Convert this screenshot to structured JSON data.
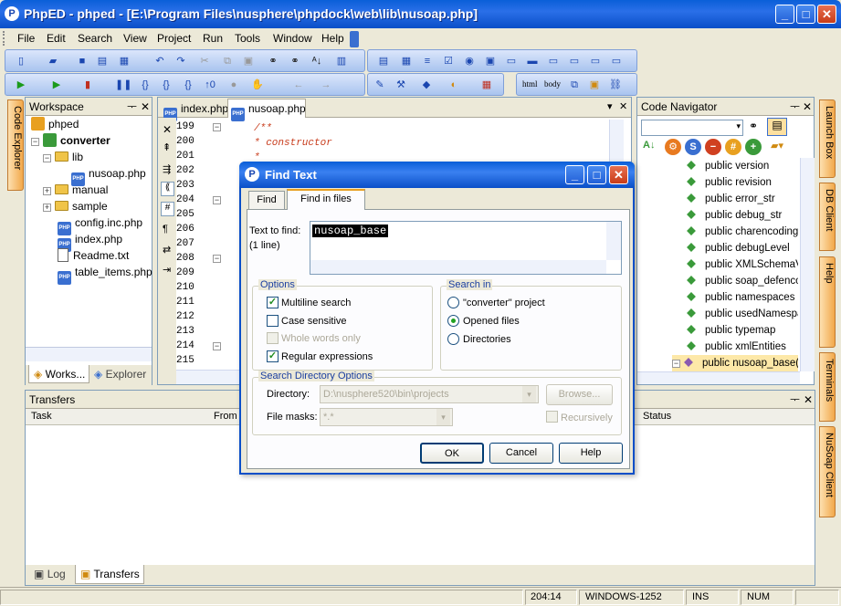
{
  "window": {
    "title": "PhpED - phped - [E:\\Program Files\\nusphere\\phpdock\\web\\lib\\nusoap.php]",
    "icon": "phped-logo-icon"
  },
  "menu": [
    "File",
    "Edit",
    "Search",
    "View",
    "Project",
    "Run",
    "Tools",
    "Window",
    "Help"
  ],
  "workspace": {
    "title": "Workspace",
    "tree": [
      {
        "label": "phped",
        "type": "project",
        "depth": 0
      },
      {
        "label": "converter",
        "type": "project",
        "depth": 1,
        "bold": true
      },
      {
        "label": "lib",
        "type": "folder",
        "depth": 2
      },
      {
        "label": "nusoap.php",
        "type": "php",
        "depth": 3
      },
      {
        "label": "manual",
        "type": "folder",
        "depth": 2
      },
      {
        "label": "sample",
        "type": "folder",
        "depth": 2
      },
      {
        "label": "config.inc.php",
        "type": "php",
        "depth": 2
      },
      {
        "label": "index.php",
        "type": "php",
        "depth": 2
      },
      {
        "label": "Readme.txt",
        "type": "txt",
        "depth": 2
      },
      {
        "label": "table_items.php",
        "type": "php",
        "depth": 2
      }
    ],
    "tabs": [
      "Works...",
      "Explorer"
    ]
  },
  "editor": {
    "tabs": [
      "index.php",
      "nusoap.php"
    ],
    "line_numbers": [
      "199",
      "200",
      "201",
      "202",
      "203",
      "204",
      "205",
      "206",
      "207",
      "208",
      "209",
      "210",
      "211",
      "212",
      "213",
      "214",
      "215"
    ],
    "visible_code": [
      "/**",
      "* constructor",
      "*"
    ]
  },
  "code_navigator": {
    "title": "Code Navigator",
    "items": [
      "public version",
      "public revision",
      "public error_str",
      "public debug_str",
      "public charencoding",
      "public debugLevel",
      "public XMLSchemaVers",
      "public soap_defencod",
      "public namespaces",
      "public usedNamespace",
      "public typemap",
      "public xmlEntities",
      "public nusoap_base()"
    ]
  },
  "side_tabs_left": [
    "Code Explorer"
  ],
  "side_tabs_right": [
    "Launch Box",
    "DB Client",
    "Help",
    "Terminals",
    "NuSoap Client"
  ],
  "transfers": {
    "title": "Transfers",
    "columns": [
      "Task",
      "From",
      "Status"
    ],
    "tabs": [
      "Log",
      "Transfers"
    ]
  },
  "dialog": {
    "title": "Find Text",
    "tabs": [
      "Find",
      "Find in files"
    ],
    "text_to_find_label": "Text to find:",
    "lines_label": "(1 line)",
    "text_value": "nusoap_base",
    "options_label": "Options",
    "options": [
      {
        "label": "Multiline search",
        "checked": true,
        "disabled": false
      },
      {
        "label": "Case sensitive",
        "checked": false,
        "disabled": false
      },
      {
        "label": "Whole words only",
        "checked": false,
        "disabled": true
      },
      {
        "label": "Regular expressions",
        "checked": true,
        "disabled": false
      }
    ],
    "search_in_label": "Search in",
    "search_in": [
      {
        "label": "\"converter\" project",
        "selected": false
      },
      {
        "label": "Opened files",
        "selected": true
      },
      {
        "label": "Directories",
        "selected": false
      }
    ],
    "dir_options_label": "Search Directory Options",
    "directory_label": "Directory:",
    "directory_value": "D:\\nusphere520\\bin\\projects",
    "browse_label": "Browse...",
    "file_masks_label": "File masks:",
    "file_masks_value": "*.*",
    "recursively_label": "Recursively",
    "ok_label": "OK",
    "cancel_label": "Cancel",
    "help_label": "Help"
  },
  "statusbar": {
    "position": "204:14",
    "encoding": "WINDOWS-1252",
    "ins": "INS",
    "num": "NUM"
  }
}
